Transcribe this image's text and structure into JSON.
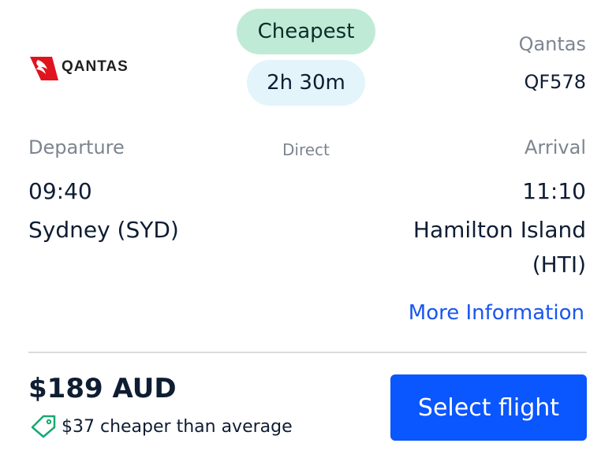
{
  "airline": {
    "logo_text": "QANTAS",
    "name": "Qantas",
    "flight_number": "QF578"
  },
  "badges": {
    "cheapest": "Cheapest",
    "duration": "2h 30m"
  },
  "route": {
    "departure_label": "Departure",
    "arrival_label": "Arrival",
    "stops": "Direct",
    "departure_time": "09:40",
    "arrival_time": "11:10",
    "departure_city": "Sydney (SYD)",
    "arrival_city": "Hamilton Island (HTI)"
  },
  "links": {
    "more_info": "More Information"
  },
  "pricing": {
    "price": "$189 AUD",
    "savings": "$37 cheaper than average"
  },
  "actions": {
    "select_flight": "Select flight"
  },
  "colors": {
    "brand_red": "#e0141e",
    "accent_blue": "#0a56ff",
    "cheapest_bg": "#bfebd6",
    "duration_bg": "#e3f4fb",
    "tag_green": "#19a873"
  },
  "icons": {
    "logo": "qantas-kangaroo-tail-icon",
    "savings": "price-tag-icon"
  }
}
